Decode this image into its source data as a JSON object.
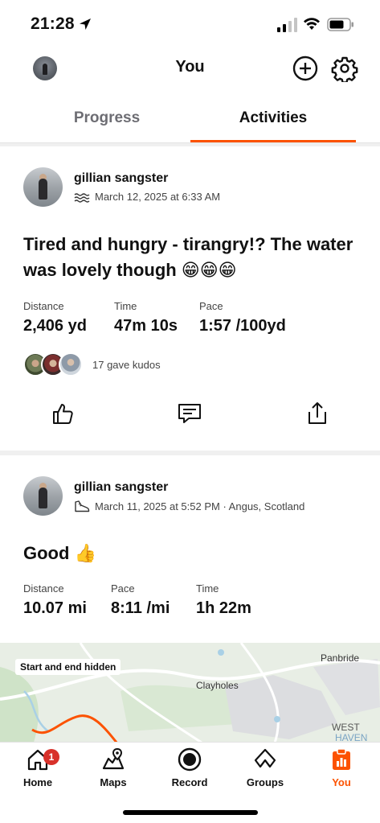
{
  "status_bar": {
    "time": "21:28"
  },
  "header": {
    "title": "You"
  },
  "tabs": [
    {
      "label": "Progress"
    },
    {
      "label": "Activities"
    }
  ],
  "activities": [
    {
      "athlete": "gillian sangster",
      "meta": "March 12, 2025 at 6:33 AM",
      "sport_icon": "swim-icon",
      "title": "Tired and hungry - tirangry!? The water was lovely though 😁😁😁",
      "stats": [
        {
          "label": "Distance",
          "value": "2,406 yd"
        },
        {
          "label": "Time",
          "value": "47m 10s"
        },
        {
          "label": "Pace",
          "value": "1:57 /100yd"
        }
      ],
      "kudos_text": "17 gave kudos"
    },
    {
      "athlete": "gillian sangster",
      "meta": "March 11, 2025 at 5:52 PM · Angus, Scotland",
      "sport_icon": "run-shoe-icon",
      "title": "Good 👍",
      "stats": [
        {
          "label": "Distance",
          "value": "10.07 mi"
        },
        {
          "label": "Pace",
          "value": "8:11 /mi"
        },
        {
          "label": "Time",
          "value": "1h 22m"
        }
      ],
      "map": {
        "badge": "Start and end hidden",
        "labels": [
          "Clayholes",
          "Panbride",
          "WEST",
          "HAVEN"
        ]
      }
    }
  ],
  "nav": [
    {
      "label": "Home",
      "icon": "home-icon",
      "badge": "1"
    },
    {
      "label": "Maps",
      "icon": "maps-icon"
    },
    {
      "label": "Record",
      "icon": "record-icon"
    },
    {
      "label": "Groups",
      "icon": "groups-icon"
    },
    {
      "label": "You",
      "icon": "you-icon",
      "active": true
    }
  ],
  "colors": {
    "accent": "#fc5200",
    "badge": "#d8312a"
  }
}
